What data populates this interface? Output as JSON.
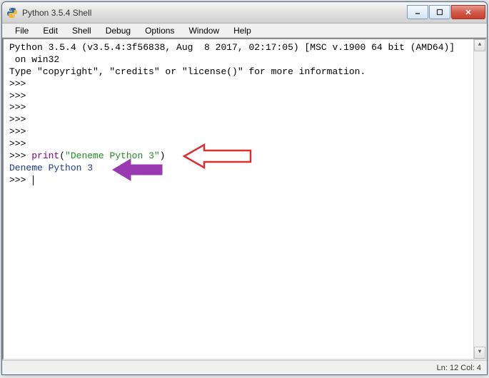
{
  "window": {
    "title": "Python 3.5.4 Shell"
  },
  "menu": {
    "file": "File",
    "edit": "Edit",
    "shell": "Shell",
    "debug": "Debug",
    "options": "Options",
    "window": "Window",
    "help": "Help"
  },
  "shell": {
    "banner1": "Python 3.5.4 (v3.5.4:3f56838, Aug  8 2017, 02:17:05) [MSC v.1900 64 bit (AMD64)]",
    "banner2": " on win32",
    "banner3": "Type \"copyright\", \"credits\" or \"license()\" for more information.",
    "prompt": ">>> ",
    "print_kw": "print",
    "paren_open": "(",
    "string_literal": "\"Deneme Python 3\"",
    "paren_close": ")",
    "output": "Deneme Python 3"
  },
  "status": {
    "ln_col": "Ln: 12   Col: 4"
  },
  "arrows": {
    "red_stroke": "#d93030",
    "purple_fill": "#9a3ab0"
  }
}
